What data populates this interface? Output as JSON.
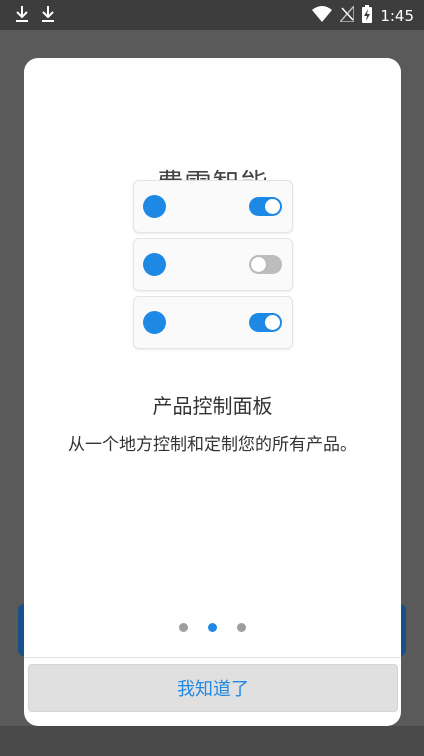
{
  "status_bar": {
    "time": "1:45",
    "icons_left": [
      "download-icon",
      "download-icon"
    ],
    "icons_right": [
      "wifi-icon",
      "no-signal-icon",
      "battery-charging-icon"
    ]
  },
  "dialog": {
    "title": "费雪智能",
    "illustration": {
      "rows": [
        {
          "dot_icon": "blue-circle-icon",
          "toggle_on": true
        },
        {
          "dot_icon": "blue-circle-icon",
          "toggle_on": false
        },
        {
          "dot_icon": "blue-circle-icon",
          "toggle_on": true
        }
      ]
    },
    "feature_title": "产品控制面板",
    "feature_description": "从一个地方控制和定制您的所有产品。",
    "pager": {
      "count": 3,
      "active_index": 1
    },
    "confirm_button": "我知道了"
  },
  "colors": {
    "accent": "#1e88e5",
    "toggle_off": "#bdbdbd",
    "pager_inactive": "#9e9e9e",
    "button_text": "#1e88e5"
  }
}
